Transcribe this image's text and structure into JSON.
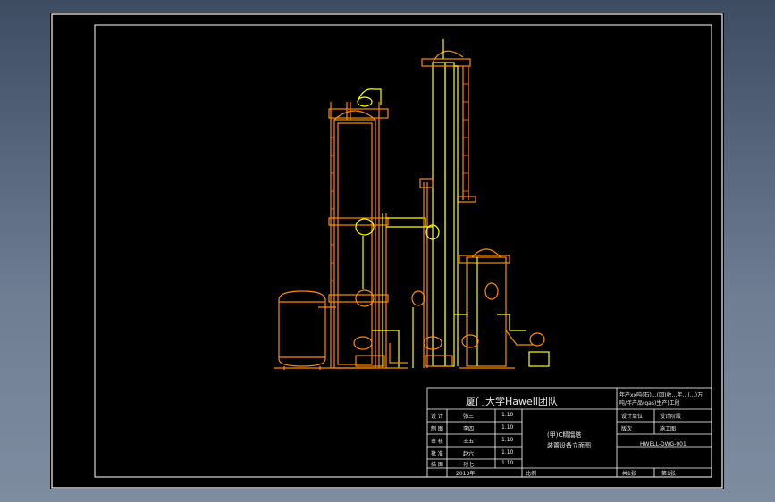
{
  "title_block": {
    "team_name": "厦门大学Hawell团队",
    "project_title_line1": "年产xx吨(石)…(回)收…年…(…)万",
    "project_title_line2": "吨/年产品(gas)生产)工段",
    "drawing_name_line1": "(甲)C精馏塔",
    "drawing_name_line2": "装置设备立面图",
    "row_labels": [
      "设 计",
      "制 图",
      "审 核",
      "批 准",
      "描 图"
    ],
    "row_names": [
      "张三",
      "李四",
      "王五",
      "赵六",
      "孙七"
    ],
    "row_dates": [
      "1.10",
      "1.10",
      "1.10",
      "1.10",
      "1.10"
    ],
    "col_header_sign": "签名",
    "col_header_date": "日期",
    "year": "2013年",
    "scale_label": "比例",
    "drawing_no": "HWELL-DWG-001",
    "sheet_label_a": "共1张",
    "sheet_label_b": "第1张",
    "stage_a": "设计阶段",
    "stage_b": "施工图",
    "design_unit": "设计单位",
    "revision": "版次"
  },
  "colors": {
    "background": "#000000",
    "frame": "#ffffff",
    "orange": "#ff8a00",
    "yellow": "#ffff00"
  }
}
